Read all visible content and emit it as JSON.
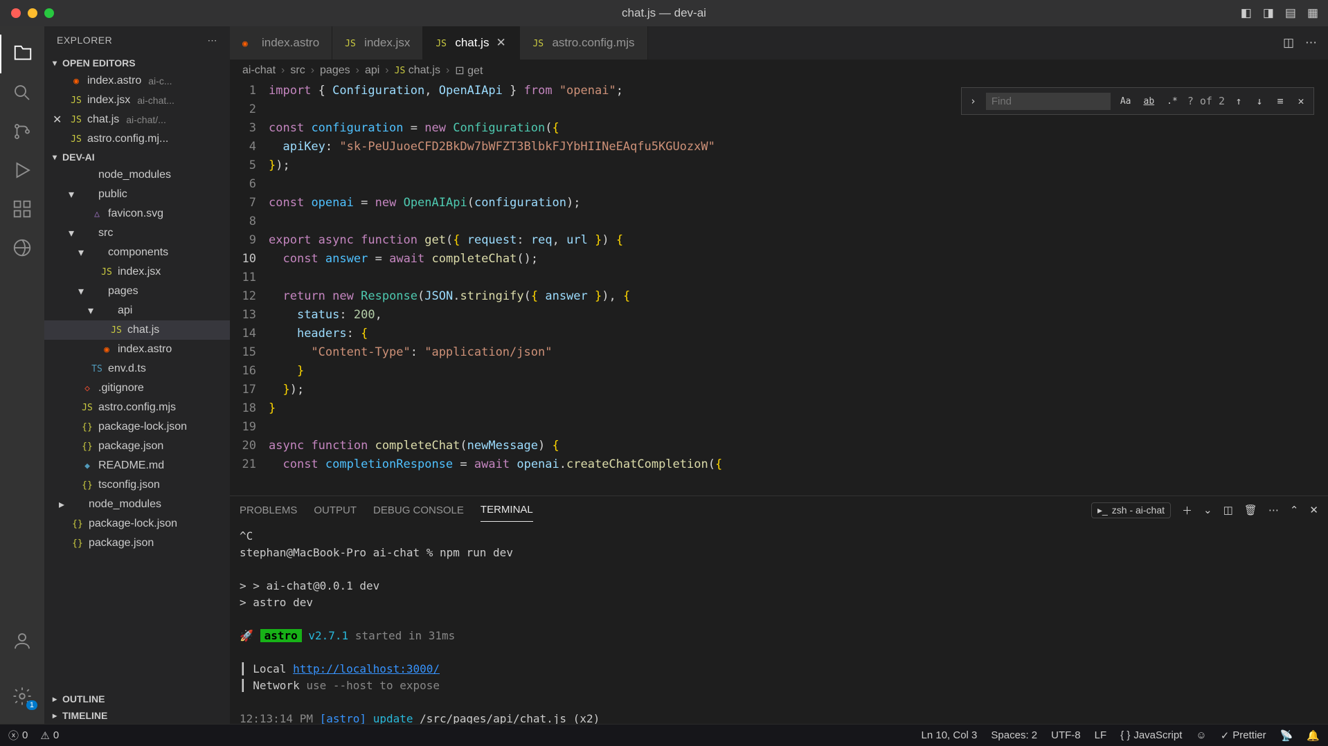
{
  "window_title": "chat.js — dev-ai",
  "activitybar": {
    "file_badge": "1"
  },
  "sidebar": {
    "title": "EXPLORER",
    "open_editors_label": "OPEN EDITORS",
    "project_label": "DEV-AI",
    "outline_label": "OUTLINE",
    "timeline_label": "TIMELINE",
    "open_editors": [
      {
        "name": "index.astro",
        "desc": "ai-c...",
        "icon": "astro"
      },
      {
        "name": "index.jsx",
        "desc": "ai-chat...",
        "icon": "jsx"
      },
      {
        "name": "chat.js",
        "desc": "ai-chat/...",
        "icon": "js",
        "closeable": true
      },
      {
        "name": "astro.config.mj...",
        "desc": "",
        "icon": "js"
      }
    ],
    "tree": [
      {
        "indent": 1,
        "chev": "",
        "icon": "",
        "name": "node_modules",
        "class": "dim scratch"
      },
      {
        "indent": 1,
        "chev": "▾",
        "icon": "",
        "name": "public"
      },
      {
        "indent": 2,
        "chev": "",
        "icon": "svg",
        "name": "favicon.svg"
      },
      {
        "indent": 1,
        "chev": "▾",
        "icon": "",
        "name": "src"
      },
      {
        "indent": 2,
        "chev": "▾",
        "icon": "",
        "name": "components"
      },
      {
        "indent": 3,
        "chev": "",
        "icon": "jsx",
        "name": "index.jsx"
      },
      {
        "indent": 2,
        "chev": "▾",
        "icon": "",
        "name": "pages"
      },
      {
        "indent": 3,
        "chev": "▾",
        "icon": "",
        "name": "api"
      },
      {
        "indent": 4,
        "chev": "",
        "icon": "js",
        "name": "chat.js",
        "selected": true
      },
      {
        "indent": 3,
        "chev": "",
        "icon": "astro",
        "name": "index.astro"
      },
      {
        "indent": 2,
        "chev": "",
        "icon": "ts",
        "name": "env.d.ts"
      },
      {
        "indent": 1,
        "chev": "",
        "icon": "git",
        "name": ".gitignore"
      },
      {
        "indent": 1,
        "chev": "",
        "icon": "js",
        "name": "astro.config.mjs"
      },
      {
        "indent": 1,
        "chev": "",
        "icon": "json",
        "name": "package-lock.json"
      },
      {
        "indent": 1,
        "chev": "",
        "icon": "json",
        "name": "package.json"
      },
      {
        "indent": 1,
        "chev": "",
        "icon": "md",
        "name": "README.md"
      },
      {
        "indent": 1,
        "chev": "",
        "icon": "json",
        "name": "tsconfig.json"
      },
      {
        "indent": 0,
        "chev": "▸",
        "icon": "",
        "name": "node_modules"
      },
      {
        "indent": 0,
        "chev": "",
        "icon": "json",
        "name": "package-lock.json"
      },
      {
        "indent": 0,
        "chev": "",
        "icon": "json",
        "name": "package.json"
      }
    ]
  },
  "tabs": [
    {
      "name": "index.astro",
      "icon": "astro",
      "active": false
    },
    {
      "name": "index.jsx",
      "icon": "jsx",
      "active": false
    },
    {
      "name": "chat.js",
      "icon": "js",
      "active": true
    },
    {
      "name": "astro.config.mjs",
      "icon": "js",
      "active": false
    }
  ],
  "breadcrumbs": [
    "ai-chat",
    "src",
    "pages",
    "api",
    "chat.js",
    "get"
  ],
  "find": {
    "placeholder": "Find",
    "result": "? of 2"
  },
  "code": {
    "active_line": 10,
    "lines": 21
  },
  "panel": {
    "tabs": [
      "PROBLEMS",
      "OUTPUT",
      "DEBUG CONSOLE",
      "TERMINAL"
    ],
    "active_tab": "TERMINAL",
    "process": "zsh - ai-chat",
    "terminal": {
      "l1": "^C",
      "l2": "stephan@MacBook-Pro ai-chat % npm run dev",
      "l3": "> ai-chat@0.0.1 dev",
      "l4": "> astro dev",
      "astro_badge": "astro",
      "astro_ver": "v2.7.1",
      "astro_started": "started in 31ms",
      "local_label": "Local",
      "local_url": "http://localhost:3000/",
      "net_label": "Network",
      "net_hint": "use --host to expose",
      "update_time": "12:13:14 PM",
      "update_tag": "[astro]",
      "update_word": "update",
      "update_path": "/src/pages/api/chat.js (x2)"
    }
  },
  "status": {
    "errors": "0",
    "warnings": "0",
    "line_col": "Ln 10, Col 3",
    "spaces": "Spaces: 2",
    "encoding": "UTF-8",
    "eol": "LF",
    "language": "JavaScript",
    "prettier": "Prettier"
  }
}
